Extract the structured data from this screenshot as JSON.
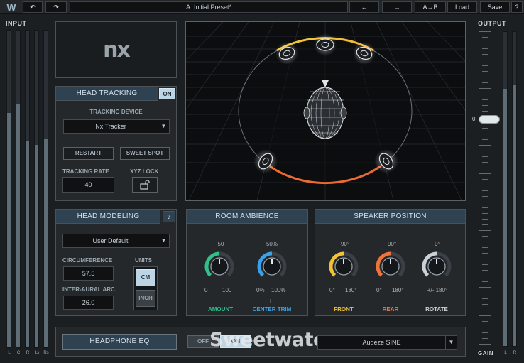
{
  "toolbar": {
    "logo": "W",
    "undo_glyph": "↶",
    "redo_glyph": "↷",
    "preset_name": "A: Initial Preset*",
    "prev_glyph": "←",
    "next_glyph": "→",
    "ab_label": "A→B",
    "load_label": "Load",
    "save_label": "Save",
    "help_label": "?"
  },
  "input": {
    "title": "INPUT",
    "channels": [
      "L",
      "C",
      "R",
      "Ls",
      "Rs"
    ],
    "levels": [
      0.74,
      0.77,
      0.65,
      0.64,
      0.66
    ]
  },
  "output": {
    "title": "OUTPUT",
    "gain_value": "0",
    "gain_title": "GAIN",
    "channels": [
      "L",
      "R"
    ],
    "levels": [
      0.82,
      0.83
    ],
    "gain_position": 0.72
  },
  "logo_panel": {
    "logo_text": "nx"
  },
  "head_tracking": {
    "title": "HEAD TRACKING",
    "on_label": "ON",
    "device_label": "TRACKING DEVICE",
    "device_value": "Nx Tracker",
    "restart_label": "RESTART",
    "sweet_spot_label": "SWEET SPOT",
    "rate_label": "TRACKING RATE",
    "rate_value": "40",
    "xyz_label": "XYZ LOCK"
  },
  "head_modeling": {
    "title": "HEAD MODELING",
    "help_label": "?",
    "profile_value": "User Default",
    "circ_label": "CIRCUMFERENCE",
    "circ_value": "57.5",
    "arc_label": "INTER-AURAL ARC",
    "arc_value": "26.0",
    "units_label": "UNITS",
    "cm_label": "CM",
    "inch_label": "INCH"
  },
  "room_ambience": {
    "title": "ROOM AMBIENCE",
    "amount": {
      "value": "50",
      "min": "0",
      "max": "100",
      "name": "AMOUNT",
      "color": "#2ec28a",
      "fraction": 0.5
    },
    "center_trim": {
      "value": "50%",
      "min": "0%",
      "max": "100%",
      "name": "CENTER TRIM",
      "color": "#3aa0e8",
      "fraction": 0.5
    }
  },
  "speaker_position": {
    "title": "SPEAKER POSITION",
    "front": {
      "value": "90°",
      "min": "0°",
      "max": "180°",
      "name": "FRONT",
      "color": "#f2c230",
      "fraction": 0.5
    },
    "rear": {
      "value": "90°",
      "min": "0°",
      "max": "180°",
      "name": "REAR",
      "color": "#f0743a",
      "fraction": 0.5
    },
    "rotate": {
      "value": "0°",
      "min": "+/- 180°",
      "name": "ROTATE",
      "color": "#c9d2d8",
      "fraction": 0.5
    }
  },
  "headphone_eq": {
    "title": "HEADPHONE EQ",
    "off_label": "OFF",
    "on_label": "ON",
    "model_value": "Audeze SINE",
    "watermark": "Sweetwater"
  }
}
